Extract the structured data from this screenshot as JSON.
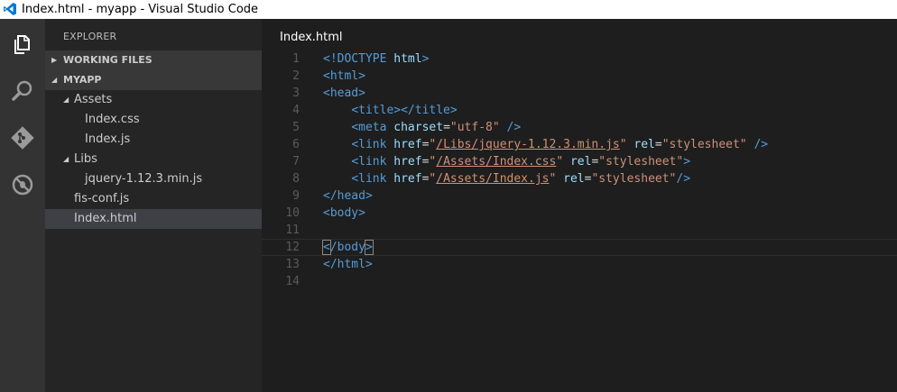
{
  "window": {
    "title": "Index.html - myapp - Visual Studio Code"
  },
  "colors": {
    "accent": "#0078d7",
    "tag": "#569cd6",
    "attribute": "#9cdcfe",
    "string": "#ce9178",
    "punctuation": "#d4d4d4"
  },
  "activity_bar": [
    "files-icon",
    "search-icon",
    "git-icon",
    "debug-icon"
  ],
  "sidebar": {
    "header": "EXPLORER",
    "working_files_label": "WORKING FILES",
    "project_label": "MYAPP",
    "tree": [
      {
        "label": "Assets",
        "type": "folder",
        "expanded": true
      },
      {
        "label": "Index.css",
        "type": "file"
      },
      {
        "label": "Index.js",
        "type": "file"
      },
      {
        "label": "Libs",
        "type": "folder",
        "expanded": true
      },
      {
        "label": "jquery-1.12.3.min.js",
        "type": "file"
      },
      {
        "label": "fis-conf.js",
        "type": "file"
      },
      {
        "label": "Index.html",
        "type": "file",
        "selected": true
      }
    ]
  },
  "editor": {
    "tab_title": "Index.html",
    "line_numbers": [
      "1",
      "2",
      "3",
      "4",
      "5",
      "6",
      "7",
      "8",
      "9",
      "10",
      "11",
      "12",
      "13",
      "14"
    ],
    "lines": [
      [
        [
          "t",
          "<!DOCTYPE"
        ],
        [
          "p",
          " "
        ],
        [
          "a",
          "html"
        ],
        [
          "t",
          ">"
        ]
      ],
      [
        [
          "t",
          "<html>"
        ]
      ],
      [
        [
          "t",
          "<head>"
        ]
      ],
      [
        [
          "p",
          "    "
        ],
        [
          "t",
          "<title></title>"
        ]
      ],
      [
        [
          "p",
          "    "
        ],
        [
          "t",
          "<meta"
        ],
        [
          "p",
          " "
        ],
        [
          "a",
          "charset"
        ],
        [
          "p",
          "="
        ],
        [
          "s",
          "\"utf-8\""
        ],
        [
          "p",
          " "
        ],
        [
          "t",
          "/>"
        ]
      ],
      [
        [
          "p",
          "    "
        ],
        [
          "t",
          "<link"
        ],
        [
          "p",
          " "
        ],
        [
          "a",
          "href"
        ],
        [
          "p",
          "="
        ],
        [
          "s",
          "\""
        ],
        [
          "u",
          "/Libs/jquery-1.12.3.min.js"
        ],
        [
          "s",
          "\""
        ],
        [
          "p",
          " "
        ],
        [
          "a",
          "rel"
        ],
        [
          "p",
          "="
        ],
        [
          "s",
          "\"stylesheet\""
        ],
        [
          "p",
          " "
        ],
        [
          "t",
          "/>"
        ]
      ],
      [
        [
          "p",
          "    "
        ],
        [
          "t",
          "<link"
        ],
        [
          "p",
          " "
        ],
        [
          "a",
          "href"
        ],
        [
          "p",
          "="
        ],
        [
          "s",
          "\""
        ],
        [
          "u",
          "/Assets/Index.css"
        ],
        [
          "s",
          "\""
        ],
        [
          "p",
          " "
        ],
        [
          "a",
          "rel"
        ],
        [
          "p",
          "="
        ],
        [
          "s",
          "\"stylesheet\""
        ],
        [
          "t",
          ">"
        ]
      ],
      [
        [
          "p",
          "    "
        ],
        [
          "t",
          "<link"
        ],
        [
          "p",
          " "
        ],
        [
          "a",
          "href"
        ],
        [
          "p",
          "="
        ],
        [
          "s",
          "\""
        ],
        [
          "u",
          "/Assets/Index.js"
        ],
        [
          "s",
          "\""
        ],
        [
          "p",
          " "
        ],
        [
          "a",
          "rel"
        ],
        [
          "p",
          "="
        ],
        [
          "s",
          "\"stylesheet\""
        ],
        [
          "t",
          "/>"
        ]
      ],
      [
        [
          "t",
          "</head>"
        ]
      ],
      [
        [
          "t",
          "<body>"
        ]
      ],
      [],
      [
        [
          "bm",
          "<"
        ],
        [
          "t",
          "/body"
        ],
        [
          "bm",
          ">"
        ]
      ],
      [
        [
          "t",
          "</html>"
        ]
      ],
      []
    ]
  }
}
